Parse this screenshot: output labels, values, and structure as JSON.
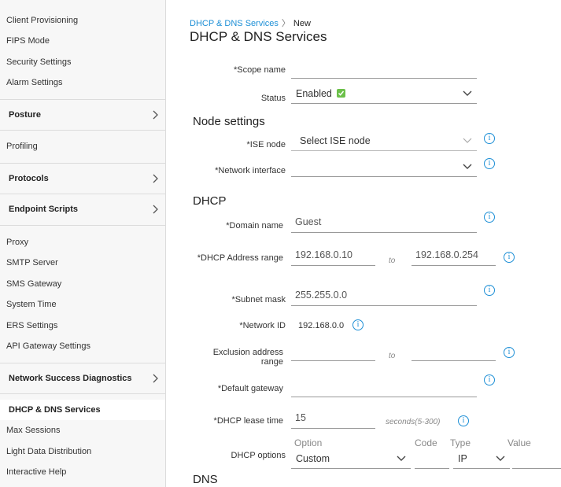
{
  "sidebar": {
    "links_top": [
      "Client Provisioning",
      "FIPS Mode",
      "Security Settings",
      "Alarm Settings"
    ],
    "group_posture": "Posture",
    "link_profiling": "Profiling",
    "group_protocols": "Protocols",
    "group_endpoint_scripts": "Endpoint Scripts",
    "links_mid": [
      "Proxy",
      "SMTP Server",
      "SMS Gateway",
      "System Time",
      "ERS Settings",
      "API Gateway Settings"
    ],
    "group_network_success": "Network Success Diagnostics",
    "active_item": "DHCP & DNS Services",
    "links_bottom": [
      "Max Sessions",
      "Light Data Distribution",
      "Interactive Help"
    ]
  },
  "breadcrumb": {
    "parent": "DHCP & DNS Services",
    "current": "New"
  },
  "page_title": "DHCP & DNS Services",
  "form": {
    "scope_name": {
      "label": "*Scope name",
      "value": ""
    },
    "status": {
      "label": "Status",
      "value": "Enabled"
    },
    "node_settings_heading": "Node settings",
    "ise_node": {
      "label": "*ISE node",
      "placeholder": "Select ISE node"
    },
    "network_interface": {
      "label": "*Network interface",
      "value": ""
    },
    "dhcp_heading": "DHCP",
    "domain_name": {
      "label": "*Domain name",
      "placeholder": "Guest"
    },
    "dhcp_range": {
      "label": "*DHCP Address range",
      "start_placeholder": "192.168.0.10",
      "to": "to",
      "end_placeholder": "192.168.0.254"
    },
    "subnet_mask": {
      "label": "*Subnet mask",
      "placeholder": "255.255.0.0"
    },
    "network_id": {
      "label": "*Network ID",
      "value": "192.168.0.0"
    },
    "exclusion_range": {
      "label": "Exclusion address range",
      "to": "to"
    },
    "default_gateway": {
      "label": "*Default gateway",
      "value": ""
    },
    "lease_time": {
      "label": "*DHCP lease time",
      "placeholder": "15",
      "hint": "seconds(5-300)"
    },
    "dhcp_options": {
      "label": "DHCP options",
      "col_option": "Option",
      "col_code": "Code",
      "col_type": "Type",
      "col_value": "Value",
      "option_value": "Custom",
      "type_value": "IP"
    },
    "dns_heading": "DNS"
  },
  "icons": {
    "info": "info-icon",
    "chevron": "chevron-right-icon",
    "caret": "chevron-down-icon",
    "check": "check-icon"
  },
  "colors": {
    "accent": "#1d8fd6",
    "check_green": "#6cc04a"
  }
}
